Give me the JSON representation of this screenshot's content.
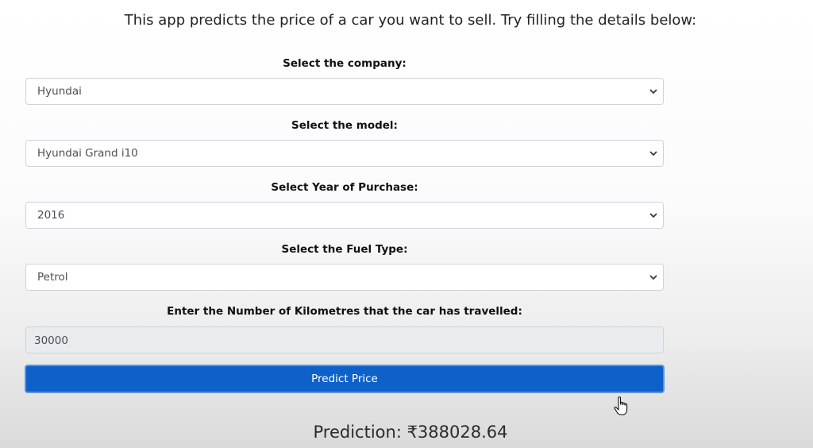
{
  "intro_text": "This app predicts the price of a car you want to sell. Try filling the details below:",
  "fields": {
    "company": {
      "label": "Select the company:",
      "value": "Hyundai"
    },
    "model": {
      "label": "Select the model:",
      "value": "Hyundai Grand i10"
    },
    "year": {
      "label": "Select Year of Purchase:",
      "value": "2016"
    },
    "fuel": {
      "label": "Select the Fuel Type:",
      "value": "Petrol"
    },
    "kms": {
      "label": "Enter the Number of Kilometres that the car has travelled:",
      "value": "30000"
    }
  },
  "predict_button_label": "Predict Price",
  "prediction_text": "Prediction: ₹388028.64",
  "icons": {
    "dropdown": "chevron-down-icon",
    "cursor": "hand-pointer-icon"
  },
  "colors": {
    "button_bg": "#0d61c9",
    "button_text": "#ffffff",
    "input_disabled_bg": "#e9ecef"
  }
}
